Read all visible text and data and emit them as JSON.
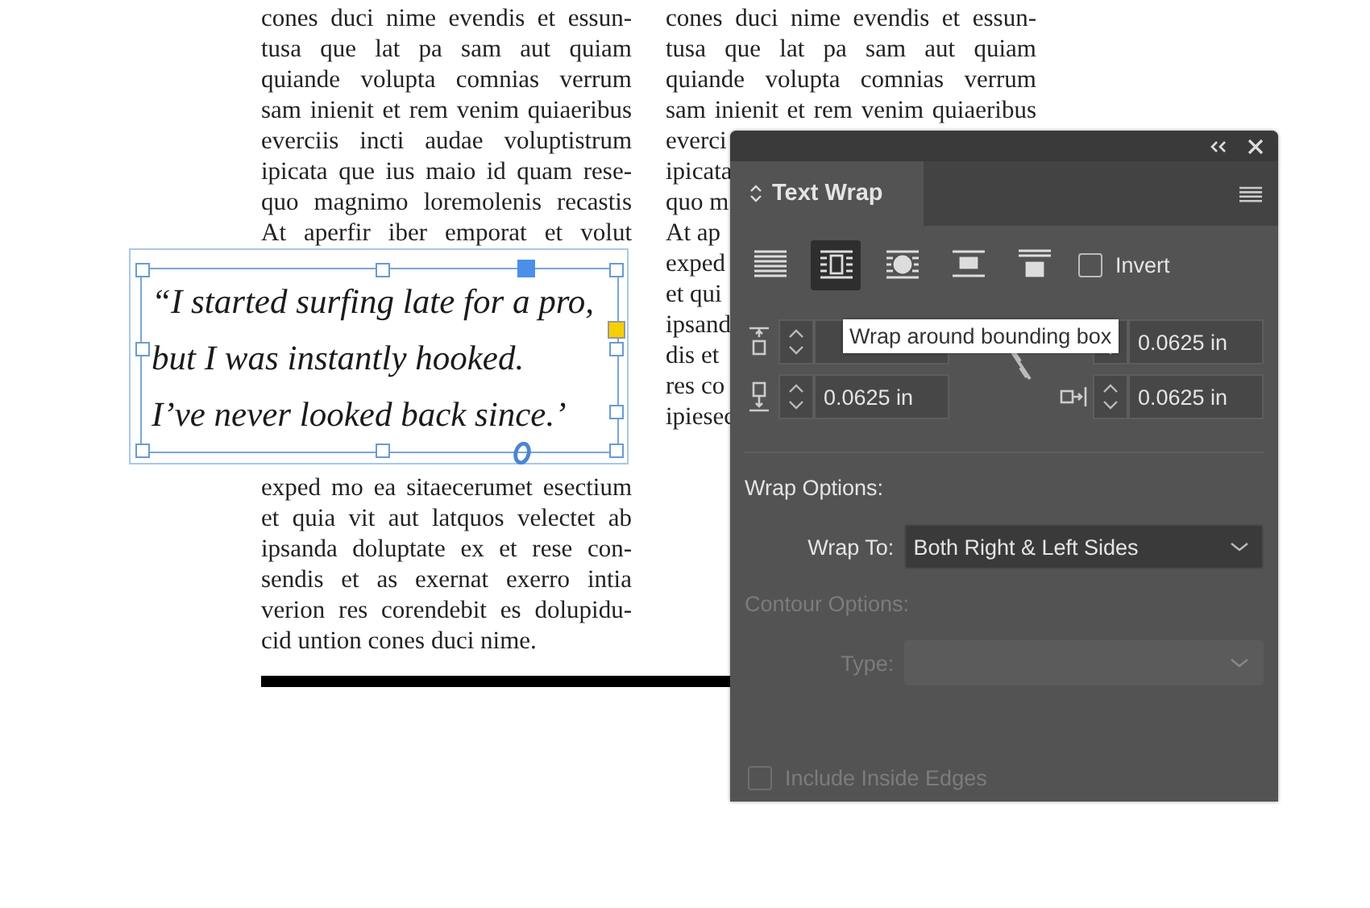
{
  "document": {
    "column_1_top": [
      "cones duci nime evendis et essun-",
      "tusa que lat pa sam aut quiam",
      "quiande volupta comnias verrum",
      "sam inienit et rem venim quiaeribus",
      "everciis incti audae voluptistrum",
      "ipicata que ius maio id quam rese-",
      "quo magnimo loremolenis recastis",
      "At aperfir iber emporat et volut"
    ],
    "pull_quote": [
      "“I started surfing late for a pro,",
      "but I was instantly hooked.",
      "I’ve never looked back since.’"
    ],
    "column_1_bottom": [
      "exped mo ea sitaecerumet esectium",
      "et quia vit aut latquos velectet ab",
      "ipsanda doluptate ex et rese con-",
      "sendis et as exernat exerro intia",
      "verion res corendebit es dolupidu-",
      "cid untion cones duci nime."
    ],
    "column_2": [
      "cones duci nime evendis et essun-",
      "tusa que lat pa sam aut quiam",
      "quiande volupta comnias verrum",
      "sam inienit et rem venim quiaeribus",
      "everci",
      "ipicata",
      "quo m",
      "At ap",
      "exped",
      "et qui",
      "ipsand",
      "dis et",
      "res co",
      "ipiesec"
    ]
  },
  "panel": {
    "title": "Text Wrap",
    "wrap_modes": [
      {
        "kind": "none",
        "selected": false
      },
      {
        "kind": "bounding",
        "selected": true
      },
      {
        "kind": "shape",
        "selected": false
      },
      {
        "kind": "jump",
        "selected": false
      },
      {
        "kind": "next",
        "selected": false
      }
    ],
    "invert": {
      "label": "Invert",
      "checked": false
    },
    "offsets": [
      {
        "kind": "top"
      },
      {
        "value": "0.0625 in"
      },
      {
        "kind": "bottom",
        "value": "0.0625 in"
      },
      {
        "kind": "right",
        "value": "0.0625 in"
      }
    ],
    "tooltip": "Wrap around bounding box",
    "wrap_options_label": "Wrap Options:",
    "wrap_to": {
      "label": "Wrap To:",
      "value": "Both Right & Left Sides"
    },
    "contour_options": {
      "label": "Contour Options:",
      "disabled": true
    },
    "type": {
      "label": "Type:",
      "disabled": true
    },
    "include_inside_edges": {
      "label": "Include Inside Edges",
      "checked": false,
      "disabled": true
    }
  }
}
